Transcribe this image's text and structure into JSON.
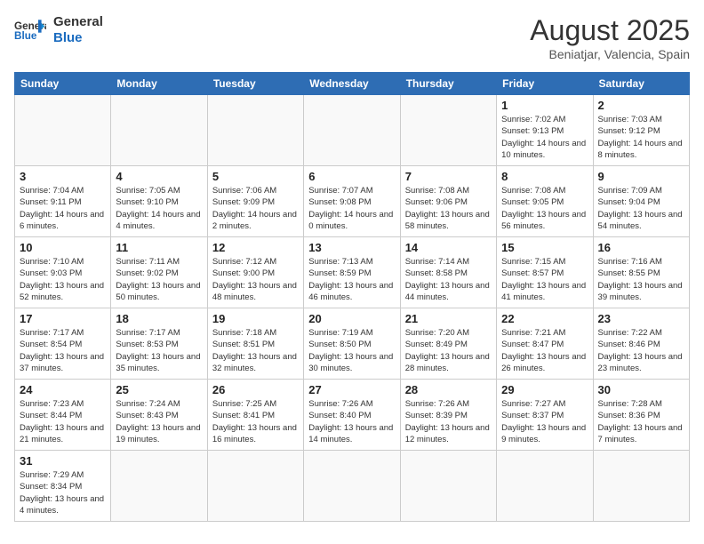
{
  "header": {
    "logo_general": "General",
    "logo_blue": "Blue",
    "title": "August 2025",
    "subtitle": "Beniatjar, Valencia, Spain"
  },
  "weekdays": [
    "Sunday",
    "Monday",
    "Tuesday",
    "Wednesday",
    "Thursday",
    "Friday",
    "Saturday"
  ],
  "weeks": [
    [
      {
        "day": "",
        "info": ""
      },
      {
        "day": "",
        "info": ""
      },
      {
        "day": "",
        "info": ""
      },
      {
        "day": "",
        "info": ""
      },
      {
        "day": "",
        "info": ""
      },
      {
        "day": "1",
        "info": "Sunrise: 7:02 AM\nSunset: 9:13 PM\nDaylight: 14 hours and 10 minutes."
      },
      {
        "day": "2",
        "info": "Sunrise: 7:03 AM\nSunset: 9:12 PM\nDaylight: 14 hours and 8 minutes."
      }
    ],
    [
      {
        "day": "3",
        "info": "Sunrise: 7:04 AM\nSunset: 9:11 PM\nDaylight: 14 hours and 6 minutes."
      },
      {
        "day": "4",
        "info": "Sunrise: 7:05 AM\nSunset: 9:10 PM\nDaylight: 14 hours and 4 minutes."
      },
      {
        "day": "5",
        "info": "Sunrise: 7:06 AM\nSunset: 9:09 PM\nDaylight: 14 hours and 2 minutes."
      },
      {
        "day": "6",
        "info": "Sunrise: 7:07 AM\nSunset: 9:08 PM\nDaylight: 14 hours and 0 minutes."
      },
      {
        "day": "7",
        "info": "Sunrise: 7:08 AM\nSunset: 9:06 PM\nDaylight: 13 hours and 58 minutes."
      },
      {
        "day": "8",
        "info": "Sunrise: 7:08 AM\nSunset: 9:05 PM\nDaylight: 13 hours and 56 minutes."
      },
      {
        "day": "9",
        "info": "Sunrise: 7:09 AM\nSunset: 9:04 PM\nDaylight: 13 hours and 54 minutes."
      }
    ],
    [
      {
        "day": "10",
        "info": "Sunrise: 7:10 AM\nSunset: 9:03 PM\nDaylight: 13 hours and 52 minutes."
      },
      {
        "day": "11",
        "info": "Sunrise: 7:11 AM\nSunset: 9:02 PM\nDaylight: 13 hours and 50 minutes."
      },
      {
        "day": "12",
        "info": "Sunrise: 7:12 AM\nSunset: 9:00 PM\nDaylight: 13 hours and 48 minutes."
      },
      {
        "day": "13",
        "info": "Sunrise: 7:13 AM\nSunset: 8:59 PM\nDaylight: 13 hours and 46 minutes."
      },
      {
        "day": "14",
        "info": "Sunrise: 7:14 AM\nSunset: 8:58 PM\nDaylight: 13 hours and 44 minutes."
      },
      {
        "day": "15",
        "info": "Sunrise: 7:15 AM\nSunset: 8:57 PM\nDaylight: 13 hours and 41 minutes."
      },
      {
        "day": "16",
        "info": "Sunrise: 7:16 AM\nSunset: 8:55 PM\nDaylight: 13 hours and 39 minutes."
      }
    ],
    [
      {
        "day": "17",
        "info": "Sunrise: 7:17 AM\nSunset: 8:54 PM\nDaylight: 13 hours and 37 minutes."
      },
      {
        "day": "18",
        "info": "Sunrise: 7:17 AM\nSunset: 8:53 PM\nDaylight: 13 hours and 35 minutes."
      },
      {
        "day": "19",
        "info": "Sunrise: 7:18 AM\nSunset: 8:51 PM\nDaylight: 13 hours and 32 minutes."
      },
      {
        "day": "20",
        "info": "Sunrise: 7:19 AM\nSunset: 8:50 PM\nDaylight: 13 hours and 30 minutes."
      },
      {
        "day": "21",
        "info": "Sunrise: 7:20 AM\nSunset: 8:49 PM\nDaylight: 13 hours and 28 minutes."
      },
      {
        "day": "22",
        "info": "Sunrise: 7:21 AM\nSunset: 8:47 PM\nDaylight: 13 hours and 26 minutes."
      },
      {
        "day": "23",
        "info": "Sunrise: 7:22 AM\nSunset: 8:46 PM\nDaylight: 13 hours and 23 minutes."
      }
    ],
    [
      {
        "day": "24",
        "info": "Sunrise: 7:23 AM\nSunset: 8:44 PM\nDaylight: 13 hours and 21 minutes."
      },
      {
        "day": "25",
        "info": "Sunrise: 7:24 AM\nSunset: 8:43 PM\nDaylight: 13 hours and 19 minutes."
      },
      {
        "day": "26",
        "info": "Sunrise: 7:25 AM\nSunset: 8:41 PM\nDaylight: 13 hours and 16 minutes."
      },
      {
        "day": "27",
        "info": "Sunrise: 7:26 AM\nSunset: 8:40 PM\nDaylight: 13 hours and 14 minutes."
      },
      {
        "day": "28",
        "info": "Sunrise: 7:26 AM\nSunset: 8:39 PM\nDaylight: 13 hours and 12 minutes."
      },
      {
        "day": "29",
        "info": "Sunrise: 7:27 AM\nSunset: 8:37 PM\nDaylight: 13 hours and 9 minutes."
      },
      {
        "day": "30",
        "info": "Sunrise: 7:28 AM\nSunset: 8:36 PM\nDaylight: 13 hours and 7 minutes."
      }
    ],
    [
      {
        "day": "31",
        "info": "Sunrise: 7:29 AM\nSunset: 8:34 PM\nDaylight: 13 hours and 4 minutes."
      },
      {
        "day": "",
        "info": ""
      },
      {
        "day": "",
        "info": ""
      },
      {
        "day": "",
        "info": ""
      },
      {
        "day": "",
        "info": ""
      },
      {
        "day": "",
        "info": ""
      },
      {
        "day": "",
        "info": ""
      }
    ]
  ]
}
